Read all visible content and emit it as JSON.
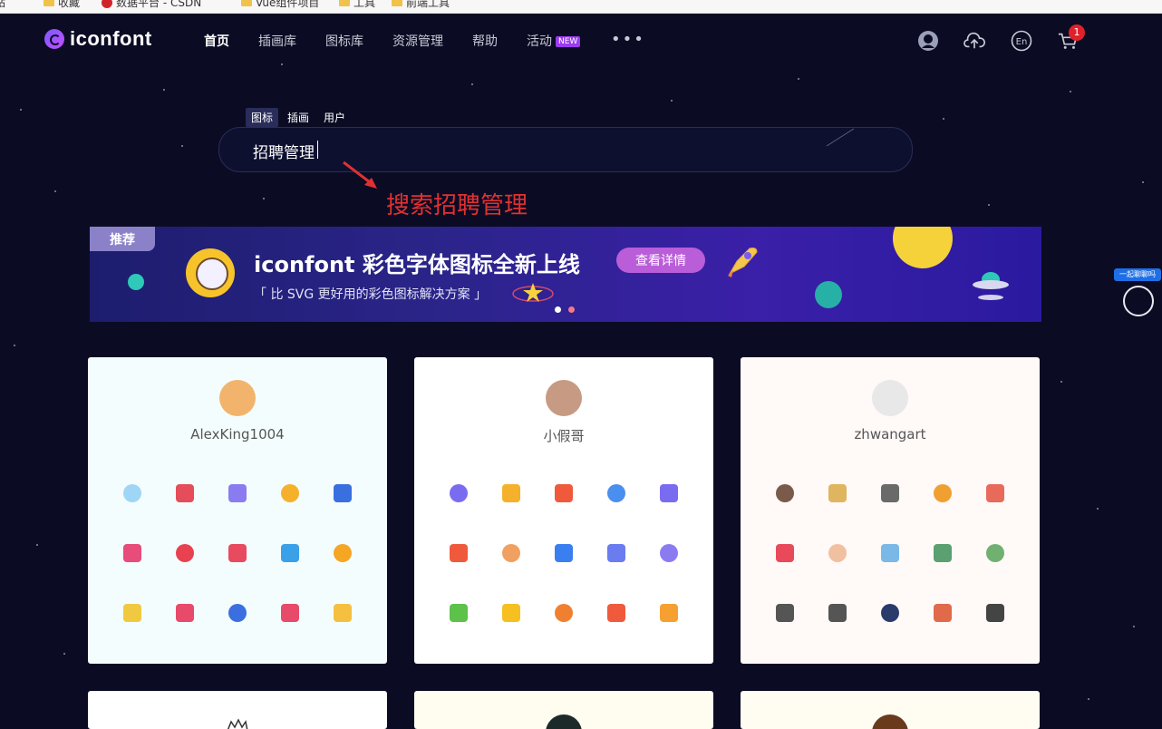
{
  "bookmarks": [
    {
      "label": "网站",
      "icon": "folder"
    },
    {
      "label": "收藏",
      "icon": "folder"
    },
    {
      "label": "数据平台 - CSDN",
      "icon": "csdn"
    },
    {
      "label": "Vue组件项目",
      "icon": "folder"
    },
    {
      "label": "工具",
      "icon": "folder"
    },
    {
      "label": "前端工具",
      "icon": "folder"
    }
  ],
  "nav": {
    "logo_text": "iconfont",
    "items": [
      "首页",
      "插画库",
      "图标库",
      "资源管理",
      "帮助",
      "活动"
    ],
    "new_badge": "NEW",
    "more": "•••",
    "cart_count": "1"
  },
  "search": {
    "tabs": [
      "图标",
      "插画",
      "用户"
    ],
    "value": "招聘管理"
  },
  "annotation": "搜索招聘管理",
  "banner": {
    "tag": "推荐",
    "title": "iconfont 彩色字体图标全新上线",
    "subtitle": "「 比 SVG 更好用的彩色图标解决方案 」",
    "button": "查看详情"
  },
  "side_widget": {
    "label": "一起聊聊吗"
  },
  "cards": [
    {
      "name": "AlexKing1004",
      "bg": "#f4fdfd",
      "avatar_color": "#f2b46d",
      "icons": [
        "#9fd6f5",
        "#e54d5a",
        "#8a7cf0",
        "#f5b12b",
        "#3a6fe0",
        "#e74c7a",
        "#e8414f",
        "#e84a5f",
        "#3aa0e8",
        "#f5a623",
        "#f0c940",
        "#e84a6a",
        "#3b6fe0",
        "#e84a6a",
        "#f5c040"
      ]
    },
    {
      "name": "小假哥",
      "bg": "#ffffff",
      "avatar_color": "#c79a83",
      "icons": [
        "#7a6cf0",
        "#f5b12b",
        "#f05a3c",
        "#4a8ff0",
        "#7a6cf0",
        "#f05a3c",
        "#f0a060",
        "#3a7ff0",
        "#6a7cf0",
        "#8a7cf0",
        "#5cc24a",
        "#f5c020",
        "#f08030",
        "#f05a3c",
        "#f5a030"
      ]
    },
    {
      "name": "zhwangart",
      "bg": "#fff9f7",
      "avatar_color": "#e8e8e8",
      "icons": [
        "#7a5a4a",
        "#e0b560",
        "#6a6a6a",
        "#f0a030",
        "#e86a5a",
        "#e84a5a",
        "#f0c0a0",
        "#7ab8e8",
        "#5aa070",
        "#70b070",
        "#555555",
        "#555555",
        "#2a3a6a",
        "#e06a4a",
        "#444444"
      ]
    }
  ],
  "cards_row2": [
    {
      "bg": "#ffffff"
    },
    {
      "bg": "#fffdf0"
    },
    {
      "bg": "#fffdf2"
    }
  ]
}
